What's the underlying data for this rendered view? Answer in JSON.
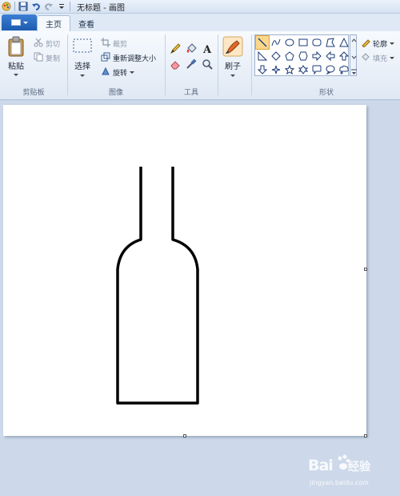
{
  "window": {
    "title": "无标题 - 画图"
  },
  "tabs": [
    {
      "label": "主页",
      "active": true
    },
    {
      "label": "查看",
      "active": false
    }
  ],
  "ribbon": {
    "clipboard": {
      "paste_label": "粘贴",
      "cut_label": "剪切",
      "copy_label": "复制",
      "group_label": "剪贴板"
    },
    "image": {
      "select_label": "选择",
      "crop_label": "裁剪",
      "resize_label": "重新调整大小",
      "rotate_label": "旋转",
      "group_label": "图像"
    },
    "tools": {
      "group_label": "工具",
      "items": [
        "pencil-icon",
        "fill-icon",
        "text-icon",
        "eraser-icon",
        "color-picker-icon",
        "magnifier-icon"
      ],
      "text_glyph": "A"
    },
    "brushes": {
      "label": "刷子"
    },
    "shapes": {
      "group_label": "形状",
      "outline_label": "轮廓",
      "fill_label": "填充",
      "items": [
        "line",
        "curve",
        "oval",
        "rectangle",
        "rounded-rectangle",
        "polygon",
        "triangle",
        "right-triangle",
        "diamond",
        "pentagon",
        "hexagon",
        "right-arrow",
        "left-arrow",
        "up-arrow",
        "down-arrow",
        "four-point-star",
        "five-point-star",
        "six-point-star",
        "rounded-callout",
        "oval-callout",
        "cloud-callout"
      ]
    }
  },
  "watermark": {
    "brand": "Bai",
    "sub": "经验",
    "url": "jingyan.baidu.com"
  },
  "colors": {
    "accent": "#1d5bb0",
    "canvas": "#ffffff",
    "workspace": "#cdd9ea",
    "selected_shape": "#fbd88b"
  }
}
